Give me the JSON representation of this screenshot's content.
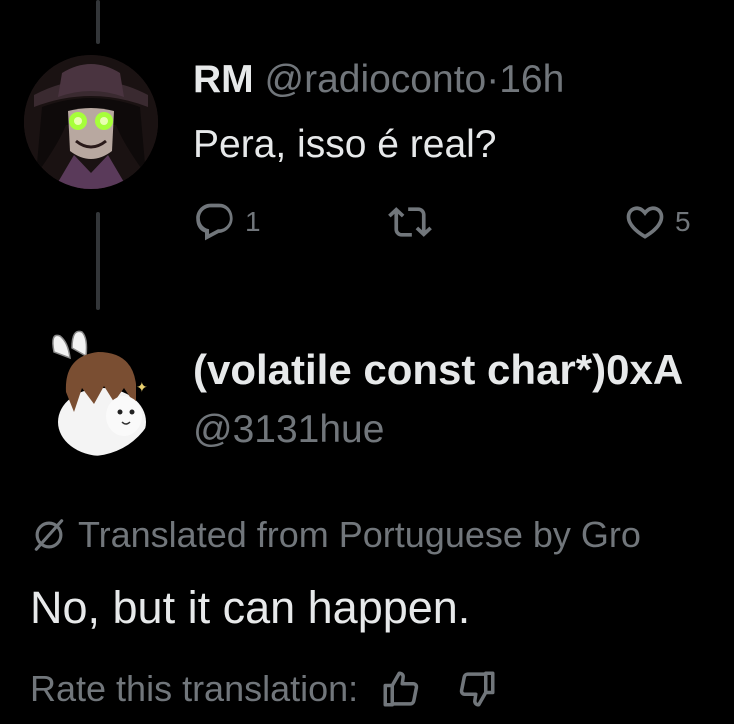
{
  "post1": {
    "display_name": "RM",
    "handle": "@radioconto",
    "separator": "·",
    "time": "16h",
    "text": "Pera, isso é real?",
    "replies": "1",
    "likes": "5",
    "icons": [
      "reply-icon",
      "retweet-icon",
      "like-icon"
    ]
  },
  "post2": {
    "display_name": "(volatile const char*)0xA",
    "handle": "@3131hue",
    "translated_note": "Translated from Portuguese by Gro",
    "text": "No, but it can happen.",
    "rate_label": "Rate this translation:",
    "icons": [
      "translate-icon",
      "thumbs-up-icon",
      "thumbs-down-icon"
    ]
  },
  "colors": {
    "background": "#000000",
    "primary_text": "#e7e9ea",
    "secondary_text": "#71767b",
    "thread_line": "#333639"
  }
}
